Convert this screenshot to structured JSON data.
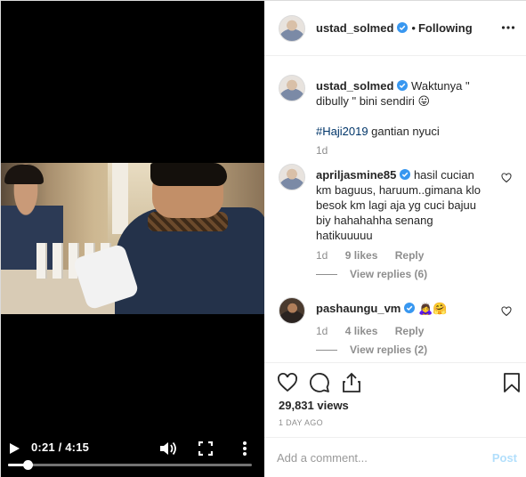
{
  "video": {
    "time_label": "0:21 / 4:15",
    "progress": 0.082
  },
  "header": {
    "username": "ustad_solmed",
    "follow_status": "Following",
    "separator": "•"
  },
  "caption": {
    "username": "ustad_solmed",
    "text": "Waktunya \" dibully \" bini sendiri 😛",
    "hashtag": "#Haji2019",
    "text2": " gantian nyuci",
    "time": "1d"
  },
  "comments": [
    {
      "username": "apriljasmine85",
      "text": "hasil cucian km baguus, haruum..gimana klo besok km lagi aja yg cuci bajuu biy hahahahha senang hatikuuuuu",
      "time": "1d",
      "likes": "9 likes",
      "reply": "Reply",
      "view_replies": "View replies (6)"
    },
    {
      "username": "pashaungu_vm",
      "text": "🙇‍♀️🤗",
      "time": "1d",
      "likes": "4 likes",
      "reply": "Reply",
      "view_replies": "View replies (2)"
    }
  ],
  "stats": {
    "views": "29,831 views",
    "date": "1 DAY AGO"
  },
  "add_comment": {
    "placeholder": "Add a comment...",
    "post_label": "Post"
  },
  "colors": {
    "link": "#003569",
    "verified": "#3897f0",
    "post_disabled": "#b2dffc",
    "muted": "#8e8e8e"
  },
  "icons": [
    "play-icon",
    "volume-icon",
    "fullscreen-icon",
    "more-vertical-icon",
    "verified-badge-icon",
    "more-horizontal-icon",
    "heart-icon",
    "comment-icon",
    "share-icon",
    "bookmark-icon"
  ]
}
